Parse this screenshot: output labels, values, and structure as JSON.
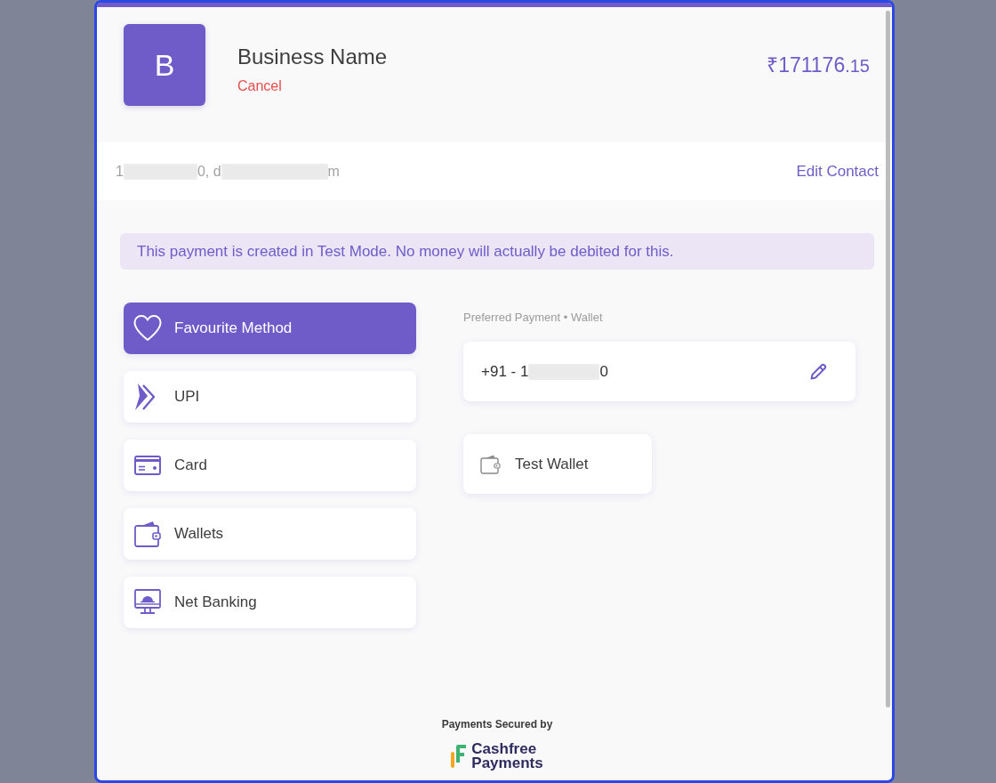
{
  "header": {
    "logo_letter": "B",
    "business_name": "Business Name",
    "cancel": "Cancel",
    "amount": "₹171176",
    "amount_fraction": ".15"
  },
  "contact": {
    "parts": [
      {
        "kind": "text",
        "text": "1"
      },
      {
        "kind": "redacted"
      },
      {
        "kind": "text",
        "text": "0, d"
      },
      {
        "kind": "redacted"
      },
      {
        "kind": "text",
        "text": "m"
      }
    ],
    "edit": "Edit Contact"
  },
  "notice": {
    "text": "This payment is created in Test Mode. No money will actually be debited for this."
  },
  "methods": [
    {
      "kind": "favourite",
      "label": "Favourite Method",
      "selected": true
    },
    {
      "kind": "upi",
      "label": "UPI",
      "selected": false
    },
    {
      "kind": "card",
      "label": "Card",
      "selected": false
    },
    {
      "kind": "wallet",
      "label": "Wallets",
      "selected": false
    },
    {
      "kind": "netbanking",
      "label": "Net Banking",
      "selected": false
    }
  ],
  "preferred": {
    "heading": "Preferred Payment • Wallet",
    "phone_parts": [
      {
        "kind": "text",
        "text": "+91 - 1"
      },
      {
        "kind": "redacted"
      },
      {
        "kind": "text",
        "text": "0"
      }
    ],
    "wallets": [
      {
        "label": "Test Wallet"
      }
    ]
  },
  "footer": {
    "secured_by": "Payments Secured by",
    "brand_line_1": "Cashfree",
    "brand_line_2": "Payments"
  }
}
